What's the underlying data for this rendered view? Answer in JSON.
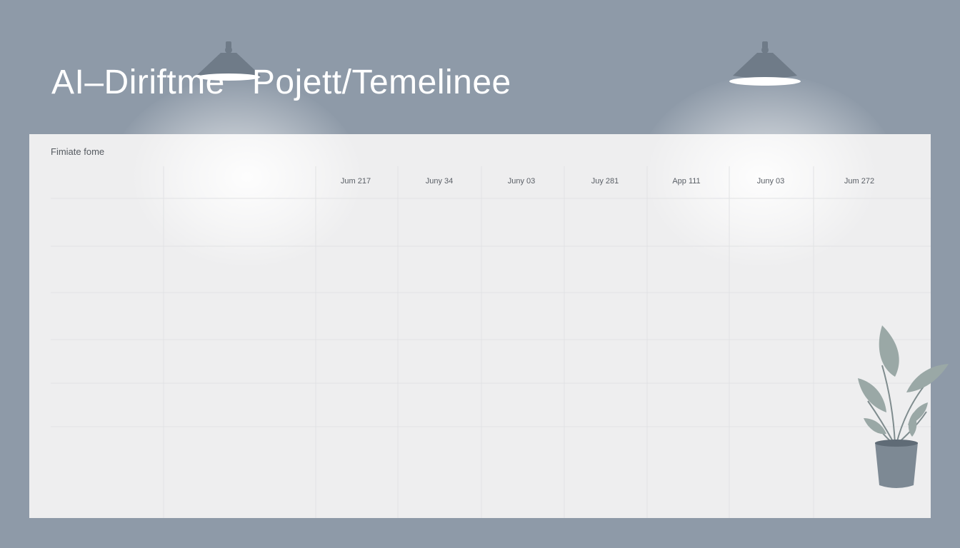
{
  "title": {
    "part_a": "AI–Diriftme",
    "part_b": "Pojett/Temelinee"
  },
  "panel": {
    "label": "Fimiate fome",
    "dates": [
      "Jum 217",
      "Juny 34",
      "Juny 03",
      "Juy 281",
      "App 111",
      "Juny 03",
      "Jum 272"
    ]
  },
  "colors": {
    "background": "#8e9aa8",
    "panel": "#eeeeef",
    "lamp": "#6f7b88",
    "plant_leaf": "#9aa8a6",
    "plant_pot": "#7d8994"
  },
  "icons": {
    "lamp": "pendant-lamp-icon",
    "plant": "potted-plant-icon"
  }
}
